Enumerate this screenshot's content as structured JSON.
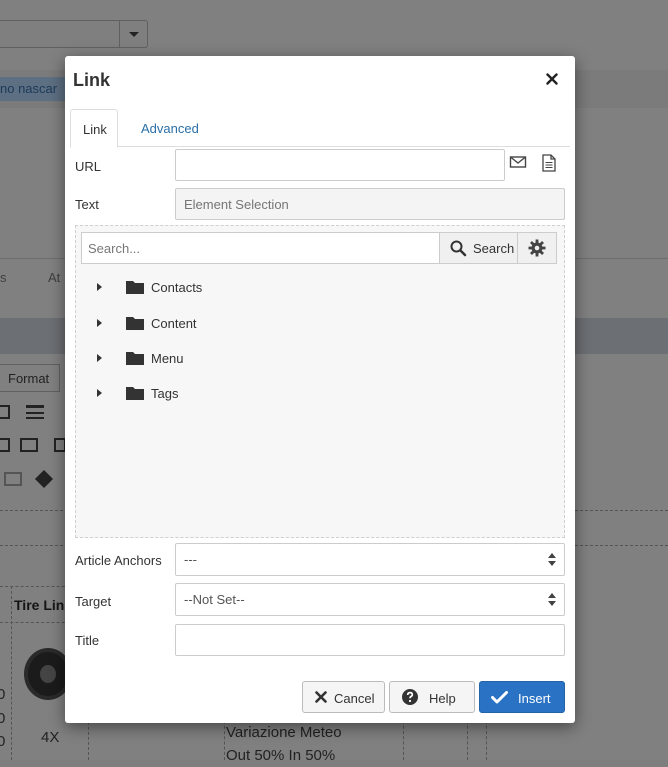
{
  "background": {
    "tag_text": "no nascar",
    "tab_s": "s",
    "tab_at": "At",
    "format_label": "Format",
    "table_header": "Tire Lin",
    "quantity": "4X",
    "row_numbers": [
      "0",
      "0",
      "0"
    ],
    "description_line1": "Variazione Meteo",
    "description_line2": "Out 50% In 50%"
  },
  "dialog": {
    "title": "Link",
    "close_icon": "close-icon",
    "tabs": [
      {
        "label": "Link",
        "active": true
      },
      {
        "label": "Advanced",
        "active": false
      }
    ],
    "url": {
      "label": "URL",
      "value": ""
    },
    "text": {
      "label": "Text",
      "placeholder": "Element Selection"
    },
    "browser": {
      "search_placeholder": "Search...",
      "search_button": "Search",
      "folders": [
        {
          "label": "Contacts"
        },
        {
          "label": "Content"
        },
        {
          "label": "Menu"
        },
        {
          "label": "Tags"
        }
      ]
    },
    "anchors": {
      "label": "Article Anchors",
      "value": "---"
    },
    "target": {
      "label": "Target",
      "value": "--Not Set--"
    },
    "title_field": {
      "label": "Title",
      "value": ""
    },
    "buttons": {
      "cancel": "Cancel",
      "help": "Help",
      "insert": "Insert"
    }
  },
  "colors": {
    "accent": "#2a73c4",
    "link": "#2a6fa8",
    "overlay": "#808080"
  }
}
